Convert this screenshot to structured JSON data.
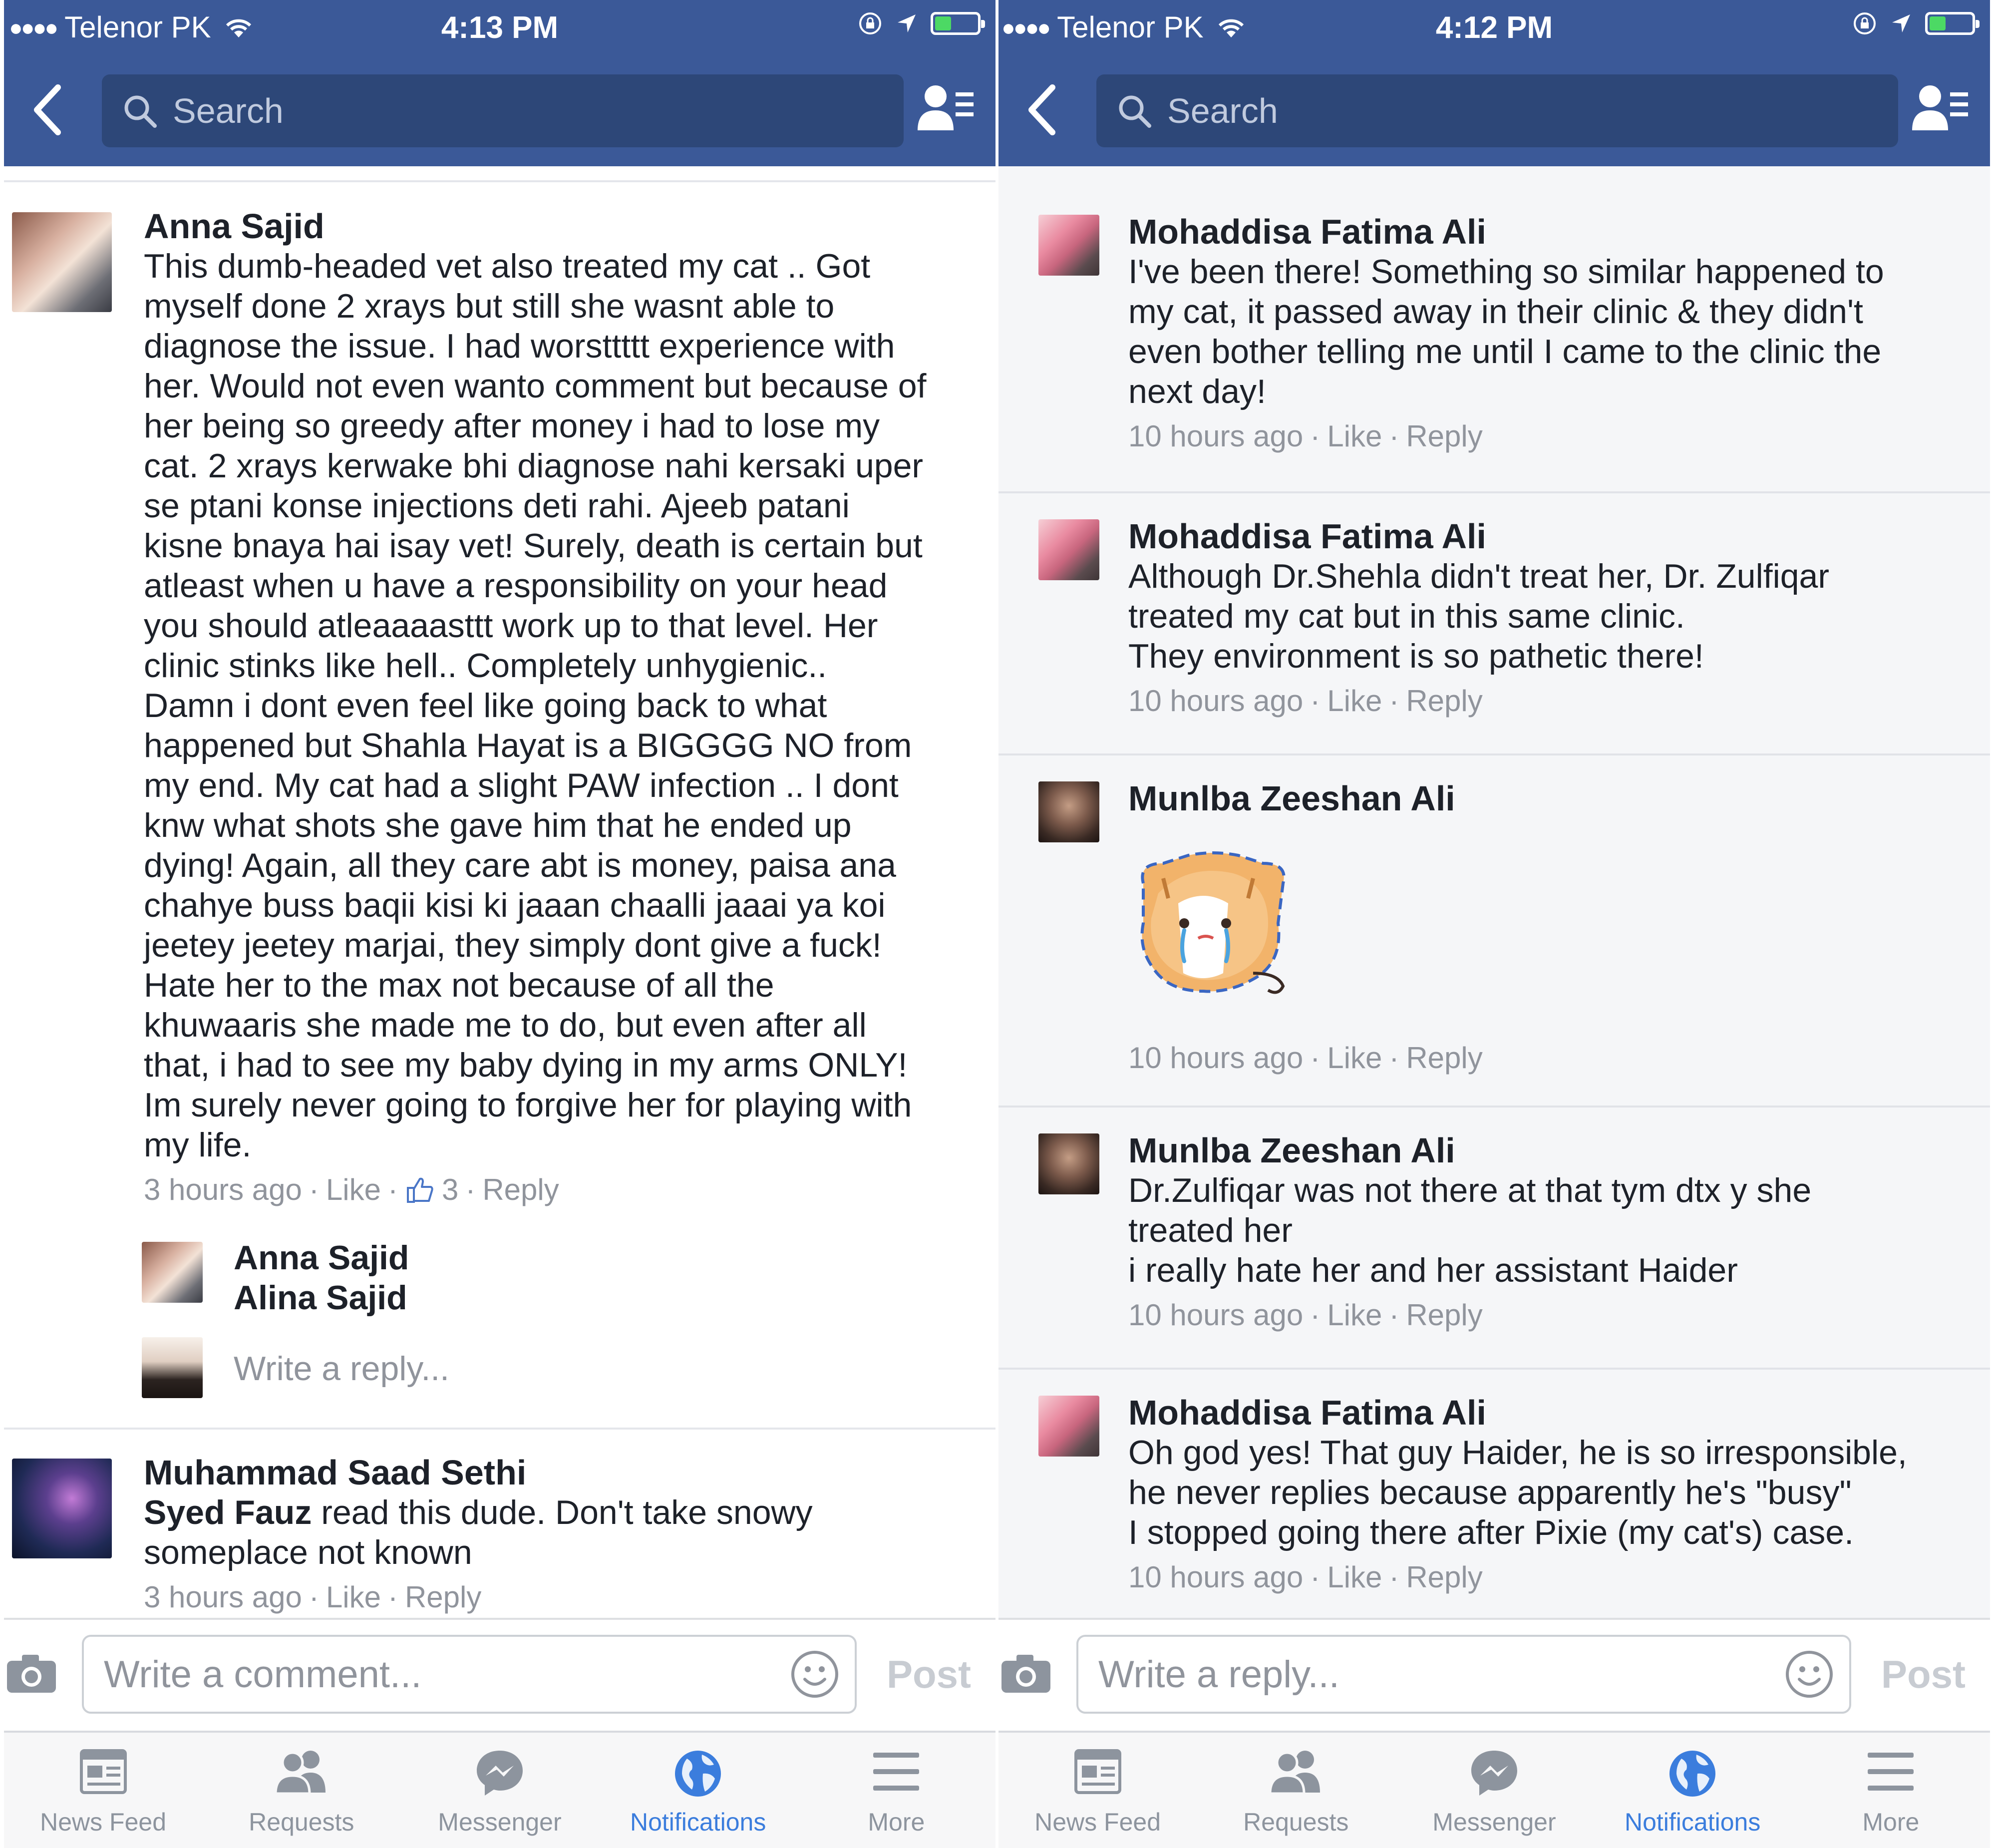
{
  "left_screen": {
    "status_bar": {
      "carrier": "Telenor PK",
      "time": "4:13 PM"
    },
    "search_placeholder": "Search",
    "comments": [
      {
        "author": "Anna Sajid",
        "lines": [
          "This dumb-headed vet also treated my cat .. Got",
          "myself done 2 xrays but still she wasnt able to",
          "diagnose the issue. I had worsttttt experience with",
          "her. Would not even wanto comment but because of",
          "her being so greedy after money i had to lose my",
          "cat. 2 xrays kerwake bhi diagnose nahi kersaki uper",
          "se ptani konse injections deti rahi. Ajeeb patani",
          "kisne bnaya hai isay vet! Surely, death is certain but",
          "atleast when u have a responsibility on your head",
          "you should atleaaaasttt work up to that level. Her",
          "clinic stinks like hell.. Completely unhygienic..",
          "Damn i dont even feel like going back to what",
          "happened but Shahla Hayat is a BIGGGG NO from",
          "my end. My cat had a slight PAW infection .. I dont",
          "knw what shots she gave him that he ended up",
          "dying! Again, all they care abt is money, paisa ana",
          "chahye buss baqii kisi ki jaaan chaalli jaaai ya koi",
          "jeetey jeetey marjai, they simply dont give a fuck!",
          "Hate her to the max not because of all the",
          "khuwaaris she made me to do, but even after all",
          "that, i had to see my baby dying in my arms ONLY!",
          "Im surely never going to forgive her for playing with",
          "my life."
        ],
        "time": "3 hours ago",
        "like": "Like",
        "like_count": "3",
        "reply": "Reply",
        "reply_summary": {
          "name1": "Anna Sajid",
          "name2": "Alina Sajid"
        },
        "write_reply_placeholder": "Write a reply..."
      },
      {
        "author": "Muhammad Saad Sethi",
        "mention": "Syed Fauz",
        "text_after_mention": " read this dude. Don't take snowy",
        "text_line2": "someplace not known",
        "time": "3 hours ago",
        "like": "Like",
        "reply": "Reply"
      }
    ],
    "composer": {
      "placeholder": "Write a comment...",
      "post_label": "Post"
    }
  },
  "right_screen": {
    "status_bar": {
      "carrier": "Telenor PK",
      "time": "4:12 PM"
    },
    "search_placeholder": "Search",
    "comments": [
      {
        "author": "Mohaddisa Fatima Ali",
        "lines": [
          "I've been there! Something so similar happened to",
          "my cat, it passed away in their clinic & they didn't",
          "even bother telling me until I came to the clinic the",
          "next day!"
        ],
        "time": "10 hours ago",
        "like": "Like",
        "reply": "Reply"
      },
      {
        "author": "Mohaddisa Fatima Ali",
        "lines": [
          "Although Dr.Shehla didn't treat her, Dr. Zulfiqar",
          "treated my cat but in this same clinic.",
          "They environment is so pathetic there!"
        ],
        "time": "10 hours ago",
        "like": "Like",
        "reply": "Reply"
      },
      {
        "author": "Munlba Zeeshan Ali",
        "sticker": "crying-cat-sticker",
        "time": "10 hours ago",
        "like": "Like",
        "reply": "Reply"
      },
      {
        "author": "Munlba Zeeshan Ali",
        "lines": [
          "Dr.Zulfiqar was not there at that tym dtx y she",
          "treated her",
          "i really hate her and her assistant Haider"
        ],
        "time": "10 hours ago",
        "like": "Like",
        "reply": "Reply"
      },
      {
        "author": "Mohaddisa Fatima Ali",
        "lines": [
          "Oh god yes! That guy Haider, he is so irresponsible,",
          "he never replies because apparently he's \"busy\"",
          "I stopped going there after Pixie (my cat's) case."
        ],
        "time": "10 hours ago",
        "like": "Like",
        "reply": "Reply"
      }
    ],
    "composer": {
      "placeholder": "Write a reply...",
      "post_label": "Post"
    }
  },
  "tab_bar": {
    "tabs": [
      {
        "label": "News Feed",
        "icon": "news-feed-icon"
      },
      {
        "label": "Requests",
        "icon": "friend-requests-icon"
      },
      {
        "label": "Messenger",
        "icon": "messenger-icon"
      },
      {
        "label": "Notifications",
        "icon": "globe-icon",
        "active": true
      },
      {
        "label": "More",
        "icon": "menu-icon"
      }
    ]
  },
  "colors": {
    "header_blue": "#3b5998",
    "search_bg": "#2d4778",
    "active_tab": "#3b7ddd",
    "meta_gray": "#90949c"
  }
}
